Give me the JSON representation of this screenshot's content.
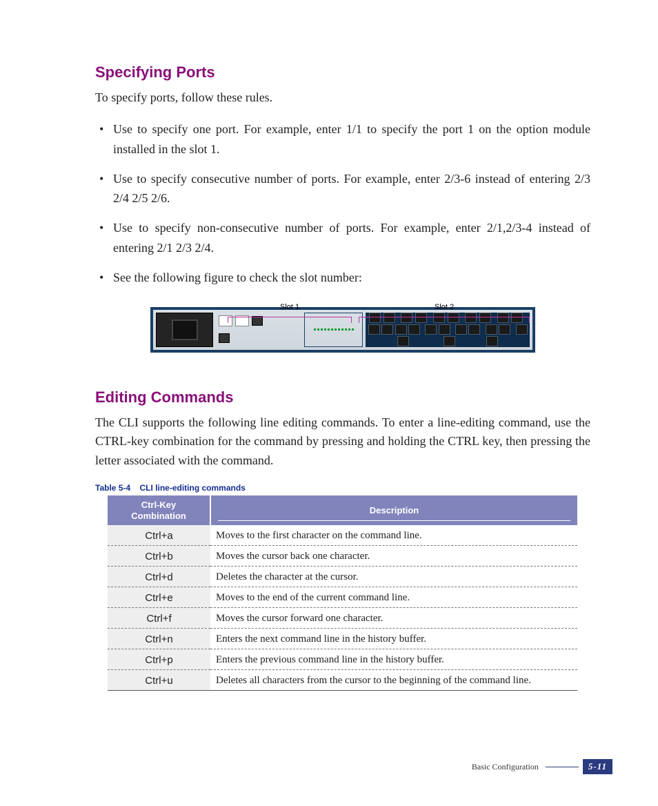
{
  "section1": {
    "heading": "Specifying Ports",
    "intro": "To specify ports, follow these rules.",
    "bullets": [
      "Use                                  to specify one port. For example, enter 1/1 to specify the port 1 on the option module installed in the slot 1.",
      "Use           to specify consecutive number of ports. For example, enter 2/3-6 instead of entering 2/3 2/4 2/5 2/6.",
      "Use             to specify non-consecutive number of ports. For example, enter 2/1,2/3-4 instead of entering 2/1 2/3 2/4.",
      "See the following figure to check the slot number:"
    ]
  },
  "diagram": {
    "slot_labels": [
      "Slot 1",
      "Slot 2"
    ],
    "port_count": 24
  },
  "section2": {
    "heading": "Editing Commands",
    "body": "The CLI supports the following line editing commands. To enter a line-editing command, use the CTRL-key combination for the command by pressing and holding the CTRL key, then pressing the letter associated with the command."
  },
  "table": {
    "caption_num": "Table 5-4",
    "caption_title": "CLI line-editing commands",
    "head": [
      "Ctrl-Key Combination",
      "Description"
    ],
    "rows": [
      [
        "Ctrl+a",
        "Moves to the first character on the command line."
      ],
      [
        "Ctrl+b",
        "Moves the cursor back one character."
      ],
      [
        "Ctrl+d",
        "Deletes the character at the cursor."
      ],
      [
        "Ctrl+e",
        "Moves to the end of the current command line."
      ],
      [
        "Ctrl+f",
        "Moves the cursor forward one character."
      ],
      [
        "Ctrl+n",
        "Enters the next command line in the history buffer."
      ],
      [
        "Ctrl+p",
        "Enters the previous command line in the history buffer."
      ],
      [
        "Ctrl+u",
        "Deletes all characters from the cursor to the beginning of the command line."
      ]
    ]
  },
  "footer": {
    "chapter": "Basic Configuration",
    "page": "5-11"
  }
}
